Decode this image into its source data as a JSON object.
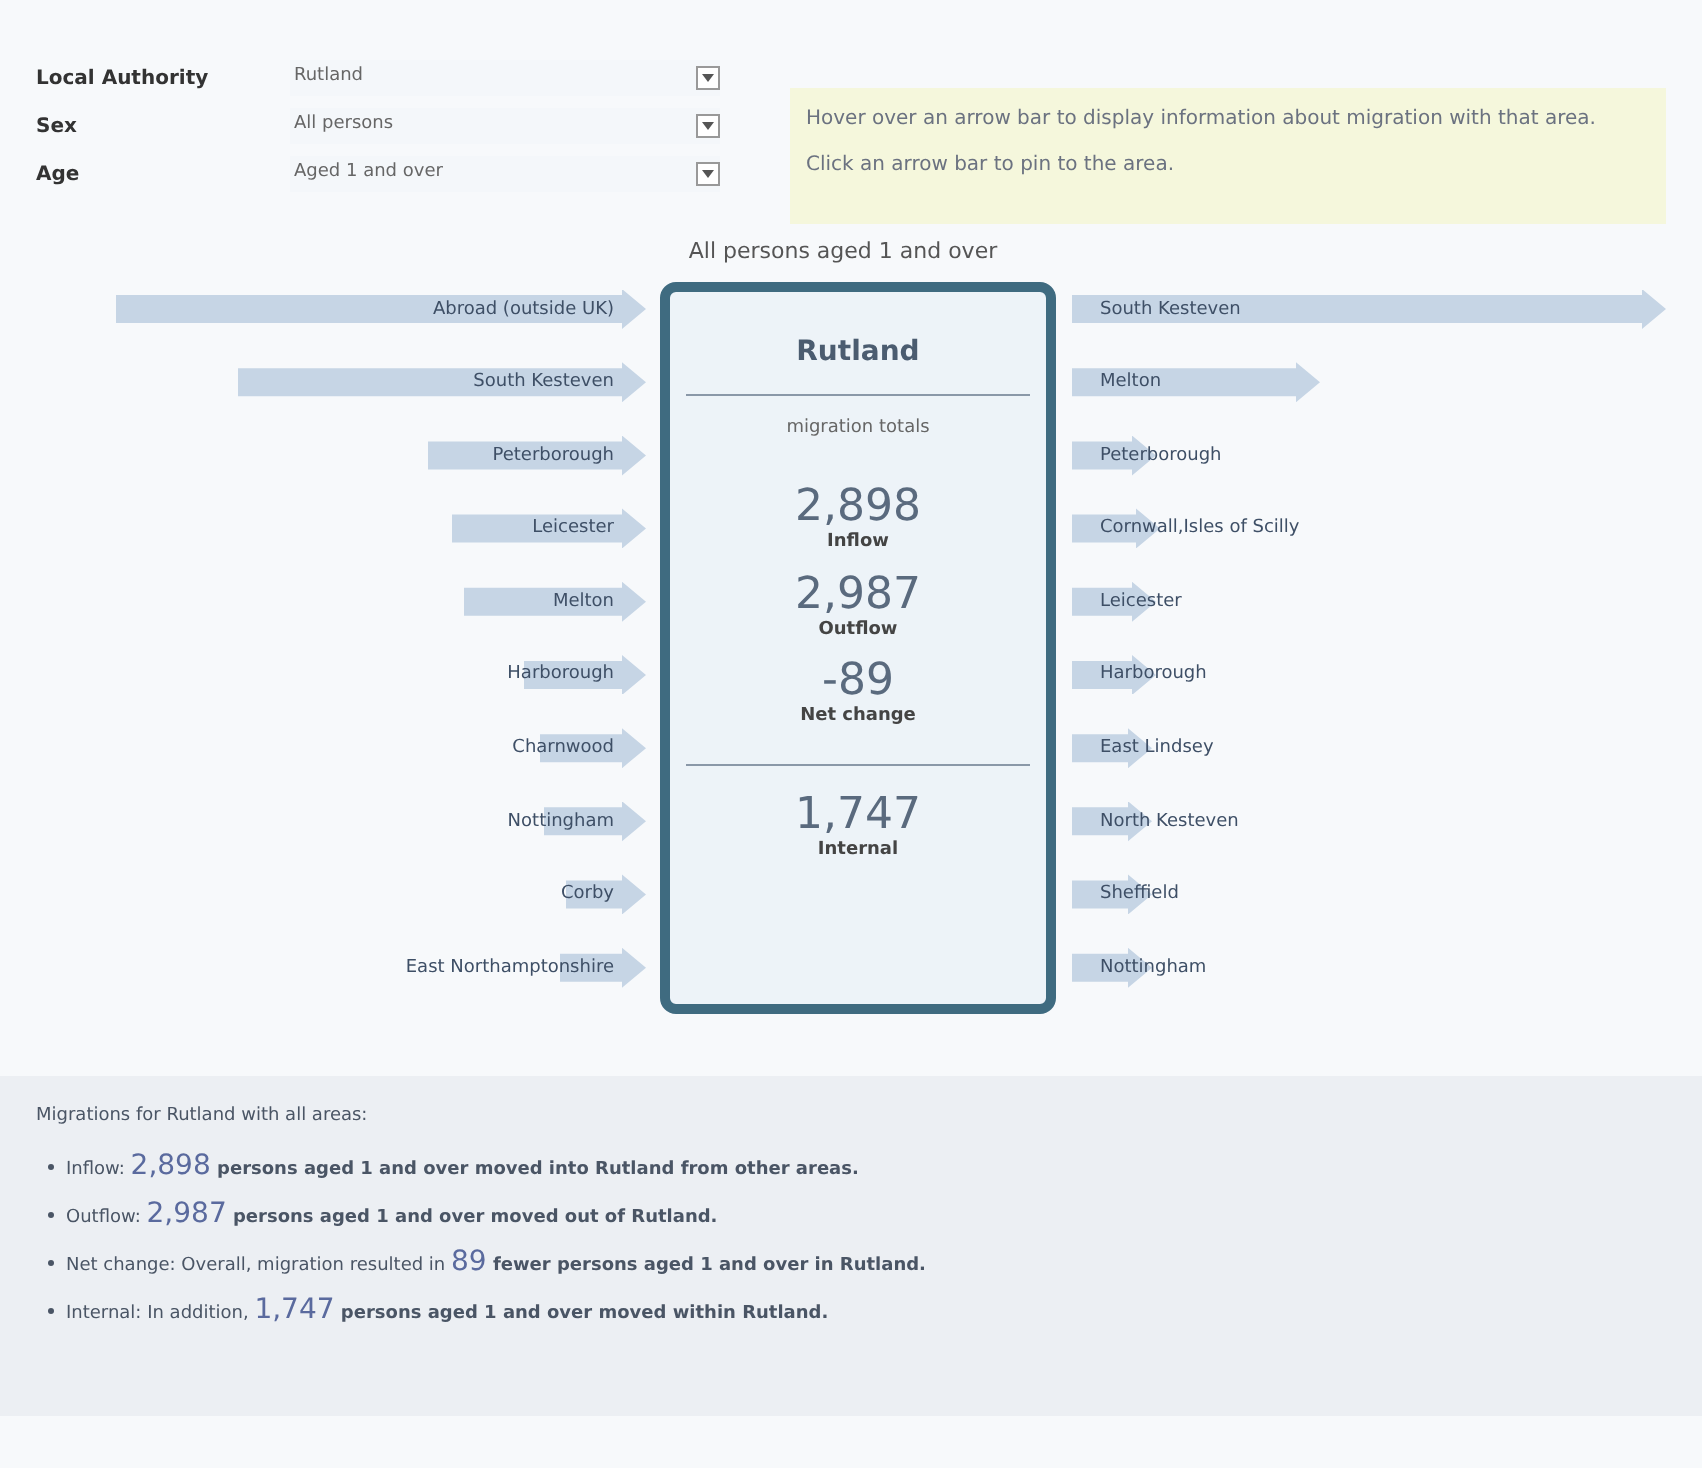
{
  "filters": [
    {
      "label": "Local Authority",
      "value": "Rutland"
    },
    {
      "label": "Sex",
      "value": "All persons"
    },
    {
      "label": "Age",
      "value": "Aged 1 and over"
    }
  ],
  "info": [
    "Hover over an arrow bar to display information about migration with that area.",
    "Click an arrow bar to pin to the area."
  ],
  "chart_title": "All persons aged 1 and over",
  "inflows": [
    "Abroad (outside UK)",
    "South Kesteven",
    "Peterborough",
    "Leicester",
    "Melton",
    "Harborough",
    "Charnwood",
    "Nottingham",
    "Corby",
    "East Northamptonshire"
  ],
  "outflows": [
    "South Kesteven",
    "Melton",
    "Peterborough",
    "Cornwall,Isles of Scilly",
    "Leicester",
    "Harborough",
    "East Lindsey",
    "North Kesteven",
    "Sheffield",
    "Nottingham"
  ],
  "totals": {
    "name": "Rutland",
    "subtitle": "migration totals",
    "figures": [
      {
        "value": "2,898",
        "label": "Inflow"
      },
      {
        "value": "2,987",
        "label": "Outflow"
      },
      {
        "value": "-89",
        "label": "Net change"
      }
    ],
    "internal": {
      "value": "1,747",
      "label": "Internal"
    }
  },
  "summary": {
    "heading": "Migrations for Rutland with all areas:",
    "items": [
      {
        "label": "Inflow:",
        "value": "2,898",
        "text": "persons aged 1 and over moved into Rutland from other areas."
      },
      {
        "label": "Outflow:",
        "value": "2,987",
        "text": "persons aged 1 and over moved out of Rutland."
      },
      {
        "label": "Net change: Overall, migration resulted in",
        "value": "89",
        "text": "fewer persons aged 1 and over in Rutland."
      },
      {
        "label": "Internal: In addition,",
        "value": "1,747",
        "text": "persons aged 1 and over moved within Rutland."
      }
    ]
  }
}
